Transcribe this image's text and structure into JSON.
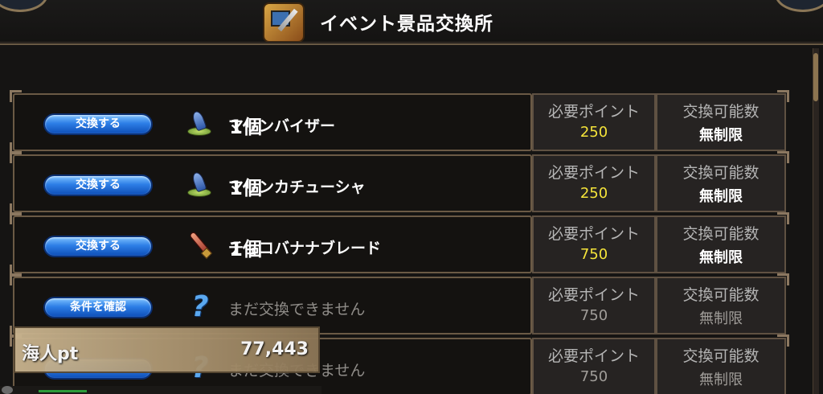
{
  "header": {
    "title": "イベント景品交換所",
    "icon": "exchange-shop-icon"
  },
  "columns": {
    "points_label": "必要ポイント",
    "limit_label": "交換可能数"
  },
  "rows": [
    {
      "button_label": "交換する",
      "icon": "marine-hat-icon",
      "name": "マリンバイザー",
      "qty": "1個",
      "points": "250",
      "limit": "無制限",
      "locked": false
    },
    {
      "button_label": "交換する",
      "icon": "marine-hat-icon",
      "name": "マリンカチューシャ",
      "qty": "1個",
      "points": "250",
      "limit": "無制限",
      "locked": false
    },
    {
      "button_label": "交換する",
      "icon": "blade-icon",
      "name": "チョコバナナブレード",
      "qty": "1個",
      "points": "750",
      "limit": "無制限",
      "locked": false
    },
    {
      "button_label": "条件を確認",
      "icon": "question-icon",
      "name": "まだ交換できません",
      "qty": "",
      "points": "750",
      "limit": "無制限",
      "locked": true
    },
    {
      "button_label": "",
      "icon": "question-icon",
      "name": "まだ交換できません",
      "qty": "",
      "points": "750",
      "limit": "無制限",
      "locked": true
    }
  ],
  "points_panel": {
    "label": "海人pt",
    "value": "77,443"
  },
  "colors": {
    "points_highlight": "#f5e43a",
    "button_blue": "#2d7ee6",
    "frame_gold": "#6b5a45"
  }
}
